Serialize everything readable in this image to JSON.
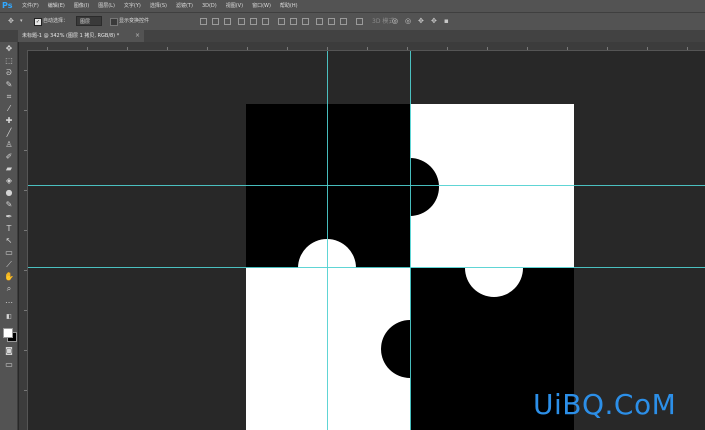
{
  "app": {
    "logo": "Ps"
  },
  "menu": [
    "文件(F)",
    "编辑(E)",
    "图像(I)",
    "图层(L)",
    "文字(Y)",
    "选择(S)",
    "滤镜(T)",
    "3D(D)",
    "视图(V)",
    "窗口(W)",
    "帮助(H)"
  ],
  "options": {
    "auto_select_label": "自动选择：",
    "auto_select_checked": true,
    "layer_select_value": "图层",
    "show_transform_label": "显示变换控件",
    "show_transform_checked": false,
    "mode_3d_label": "3D 模式："
  },
  "document_tab": {
    "title": "未标题-1 @ 342% (图层 1 拷贝, RGB/8) *",
    "close": "×"
  },
  "colors": {
    "guide": "#4fd0d0",
    "workspace": "#282828",
    "panel": "#535353",
    "foreground": "#ffffff",
    "background": "#000000",
    "watermark": "#2c8fe8"
  },
  "watermark": {
    "text": "UiBQ.CoM"
  }
}
